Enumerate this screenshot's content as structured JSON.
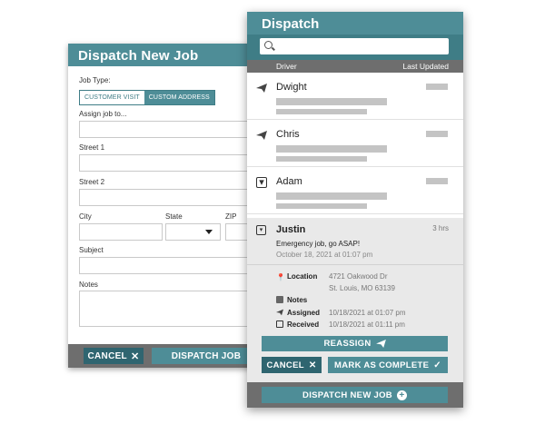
{
  "newjob": {
    "title": "Dispatch New Job",
    "job_type_label": "Job Type:",
    "job_type_options": [
      "CUSTOMER VISIT",
      "CUSTOM ADDRESS"
    ],
    "assign_label": "Assign job to...",
    "street1_label": "Street 1",
    "street2_label": "Street 2",
    "city_label": "City",
    "state_label": "State",
    "zip_label": "ZIP",
    "subject_label": "Subject",
    "notes_label": "Notes",
    "cancel_label": "CANCEL",
    "dispatch_label": "DISPATCH JOB"
  },
  "dispatch": {
    "title": "Dispatch",
    "search_placeholder": "",
    "col_driver": "Driver",
    "col_updated": "Last Updated",
    "drivers": [
      {
        "name": "Dwight",
        "icon": "send-icon"
      },
      {
        "name": "Chris",
        "icon": "send-icon"
      },
      {
        "name": "Adam",
        "icon": "inbox-icon"
      }
    ],
    "selected": {
      "name": "Justin",
      "icon": "inbox-icon",
      "time": "3 hrs",
      "message": "Emergency job, go ASAP!",
      "date": "October 18, 2021 at 01:07 pm",
      "location_label": "Location",
      "location_line1": "4721 Oakwood Dr",
      "location_line2": "St. Louis, MO 63139",
      "notes_label": "Notes",
      "assigned_label": "Assigned",
      "assigned_value": "10/18/2021 at 01:07 pm",
      "received_label": "Received",
      "received_value": "10/18/2021 at 01:11 pm"
    },
    "reassign_label": "REASSIGN",
    "cancel_label": "CANCEL",
    "complete_label": "MARK AS COMPLETE",
    "new_job_label": "DISPATCH NEW JOB"
  },
  "colors": {
    "accent": "#4e8d97",
    "accent_dark": "#2f6570",
    "footer": "#6e6e6e"
  }
}
